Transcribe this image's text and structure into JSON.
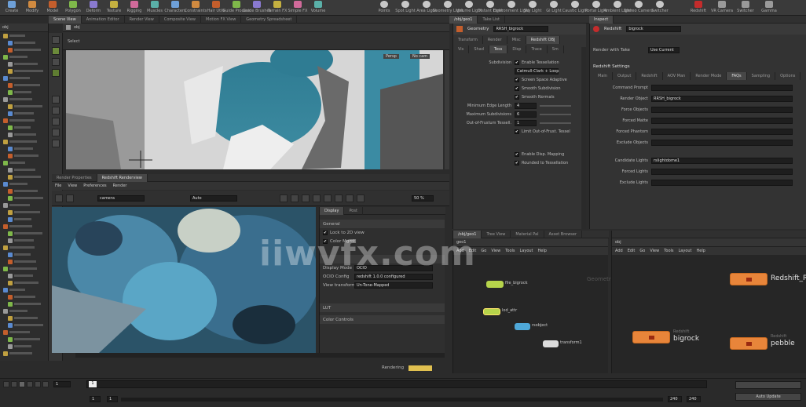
{
  "toolbar": {
    "left_items": [
      "Create",
      "Modify",
      "Model",
      "Polygon",
      "Deform",
      "Texture",
      "Rigging",
      "Muscles",
      "Characters",
      "Constraints",
      "Hair Utils",
      "Guide Process",
      "Guide Brushes",
      "Terrain FX",
      "Simple FX",
      "Volume"
    ],
    "right_items": [
      "Points",
      "Spot Light",
      "Area Light",
      "Geometry Light",
      "Volume Light",
      "Distant Light",
      "Environment Light",
      "Sky Light",
      "GI Light",
      "Caustic Light",
      "Portal Light",
      "Ambient Light",
      "Stereo Camera",
      "Switcher"
    ],
    "far_right": [
      "Redshift",
      "VR Camera",
      "Switcher",
      "Gamma"
    ]
  },
  "tabs_left": [
    "Scene View",
    "Animation Editor",
    "Render View",
    "Composite View",
    "Motion FX View",
    "Geometry Spreadsheet"
  ],
  "tabs_params": [
    "/obj/geo1",
    "Take List"
  ],
  "tabs_right_top": [
    "Inspect"
  ],
  "tabs_network": [
    "/obj/geo1",
    "Tree View",
    "Material Pal",
    "Asset Browser"
  ],
  "path_obj": "obj",
  "path_viewport": "obj",
  "viewport": {
    "view_label": "Select",
    "persp": "Persp",
    "cam": "No cam"
  },
  "render_view": {
    "tabs": [
      "Render Properties",
      "Redshift Renderview"
    ],
    "menu": [
      "File",
      "View",
      "Preferences",
      "Render"
    ],
    "camera_field": "camera",
    "aov_field": "Auto",
    "zoom": "50 %"
  },
  "render_side": {
    "tabs": [
      "Display",
      "Post"
    ],
    "sections": [
      "General",
      "Display Mode",
      "OCIO Config",
      "View transform"
    ],
    "checks": [
      "Lock to 2D view",
      "Color Mgmt"
    ],
    "display_mode": "OCIO",
    "ocio_config": "redshift 1.0.0 configured",
    "view_transform": "Un-Tone-Mapped",
    "bottom_sections": [
      "LUT",
      "Color Controls"
    ]
  },
  "params_geo": {
    "header": "Geometry",
    "node_name": "RRSH_bigrock",
    "tabs": [
      "Transform",
      "Render",
      "Misc",
      "Redshift OBJ"
    ],
    "subtabs": [
      "Vis",
      "Shad",
      "Tess",
      "Disp",
      "Trace",
      "Sm"
    ],
    "rows": [
      {
        "label": "Subdivision",
        "type": "check",
        "value": "Enable Tessellation"
      },
      {
        "label": "",
        "type": "field",
        "value": "Catmull-Clark + Loop"
      },
      {
        "label": "",
        "type": "check",
        "value": "Screen Space Adaptive"
      },
      {
        "label": "",
        "type": "check",
        "value": "Smooth Subdivision"
      },
      {
        "label": "",
        "type": "check",
        "value": "Smooth Normals"
      },
      {
        "label": "Minimum Edge Length",
        "type": "num",
        "value": "4"
      },
      {
        "label": "Maximum Subdivisions",
        "type": "num",
        "value": "6"
      },
      {
        "label": "Out-of-Frustum Tessell.",
        "type": "num",
        "value": "1"
      },
      {
        "label": "",
        "type": "check",
        "value": "Limit Out-of-Frust. Tessel"
      }
    ],
    "displacement_checks": [
      "Enable Disp. Mapping",
      "Rounded to Tessellation"
    ]
  },
  "params_rs": {
    "header": "Redshift",
    "node_name": "bigrock",
    "render_field_label": "Render with Take",
    "render_field": "Use Current",
    "section": "Redshift Settings",
    "tabs": [
      "Main",
      "Output",
      "Redshift",
      "AOV Man",
      "Render Mode",
      "FAQs",
      "Sampling",
      "Options"
    ],
    "fields": [
      {
        "label": "Command Prompt",
        "value": ""
      },
      {
        "label": "Render Object",
        "value": "RRSH_bigrock"
      },
      {
        "label": "Force Objects",
        "value": ""
      },
      {
        "label": "Forced Matte",
        "value": ""
      },
      {
        "label": "Forced Phantom",
        "value": ""
      },
      {
        "label": "Exclude Objects",
        "value": ""
      },
      {
        "label": "Candidate Lights",
        "value": "rslightdome1"
      },
      {
        "label": "Forced Lights",
        "value": ""
      },
      {
        "label": "Exclude Lights",
        "value": ""
      }
    ]
  },
  "network_left": {
    "menu": [
      "Add",
      "Edit",
      "Go",
      "View",
      "Tools",
      "Layout",
      "Help"
    ],
    "path": "geo1",
    "context": "Geometry",
    "nodes": [
      "file_bigrock",
      "lod_attr",
      "rsobject",
      "transform1"
    ]
  },
  "network_right": {
    "menu": [
      "Add",
      "Edit",
      "Go",
      "View",
      "Tools",
      "Layout",
      "Help"
    ],
    "path": "obj",
    "nodes": [
      {
        "name": "Redshift_ROP"
      },
      {
        "name": "bigrock",
        "sub": "Redshift"
      },
      {
        "name": "pebble",
        "sub": "Redshift"
      }
    ]
  },
  "timeline": {
    "frame_start": "1",
    "frame_end": "240",
    "frame_end2": "240",
    "current": "1",
    "range_start": "1",
    "range_end": "1",
    "status": "Rendering",
    "keys_label": "Auto Update"
  },
  "watermark": "iiwvfx.com",
  "colors": {
    "node_orange": "#e8853a",
    "node_green": "#b6d44b",
    "node_blue": "#4fa8d8",
    "accent_yellow": "#e0c050"
  }
}
